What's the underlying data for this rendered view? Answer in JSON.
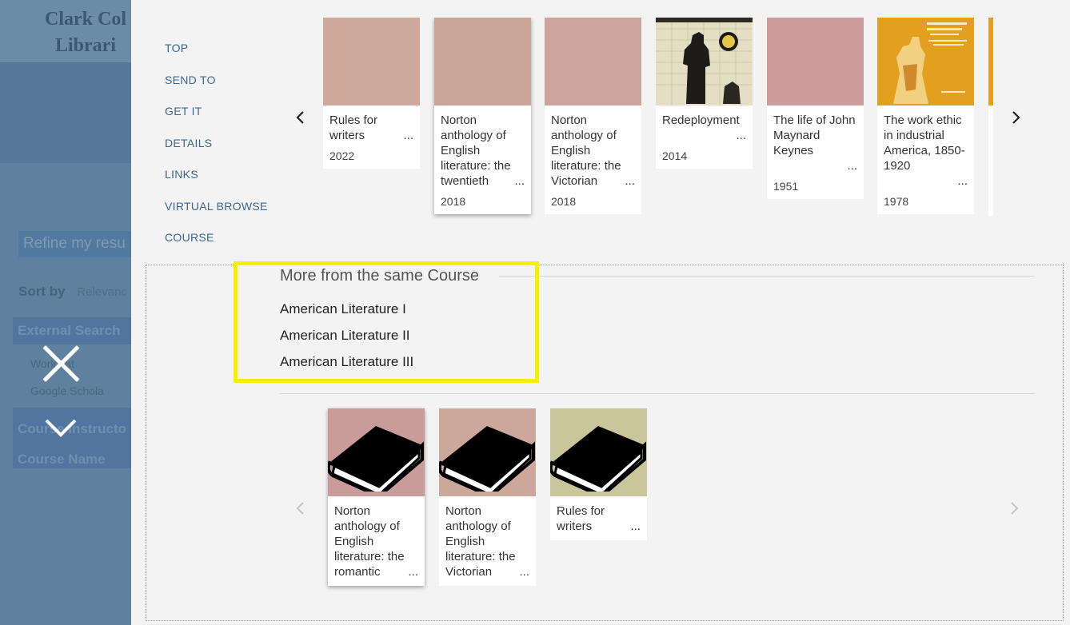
{
  "background": {
    "logo_line1": "Clark Col",
    "logo_line2": "Librari",
    "refine": "Refine my resu",
    "sort_label": "Sort by",
    "sort_value": "Relevanc",
    "external_search": "External Search",
    "link_worldcat": "Worldcat",
    "link_scholar": "Google Schola",
    "course_instructor": "Course Instructo",
    "course_name": "Course Name"
  },
  "nav": {
    "items": [
      "TOP",
      "SEND TO",
      "GET IT",
      "DETAILS",
      "LINKS",
      "VIRTUAL BROWSE",
      "COURSE"
    ]
  },
  "top_carousel": {
    "items": [
      {
        "title": "Rules for writers",
        "year": "2022",
        "cover_color": "#cea99c"
      },
      {
        "title": "Norton anthology of English literature: the twentieth",
        "year": "2018",
        "cover_color": "#cba59a"
      },
      {
        "title": "Norton anthology of English literature: the Victorian",
        "year": "2018",
        "cover_color": "#cea59c"
      },
      {
        "title": "Redeployment",
        "year": "2014",
        "cover_color": "#d9d2b0"
      },
      {
        "title": "The life of John Maynard Keynes",
        "year": "1951",
        "cover_color": "#cd9c9c"
      },
      {
        "title": "The work ethic in industrial America, 1850-1920",
        "year": "1978",
        "cover_color": "#e3a21e"
      }
    ]
  },
  "course": {
    "heading": "More from the same Course",
    "links": [
      "American Literature I",
      "American Literature II",
      "American Literature III"
    ]
  },
  "bottom_carousel": {
    "items": [
      {
        "title": "Norton anthology of English literature: the romantic",
        "cover_color": "#c99b9b"
      },
      {
        "title": "Norton anthology of English literature: the Victorian",
        "cover_color": "#cba899"
      },
      {
        "title": "Rules for writers",
        "cover_color": "#c9c69c"
      }
    ]
  },
  "arrows": {
    "prev": "‹",
    "next": "›"
  }
}
